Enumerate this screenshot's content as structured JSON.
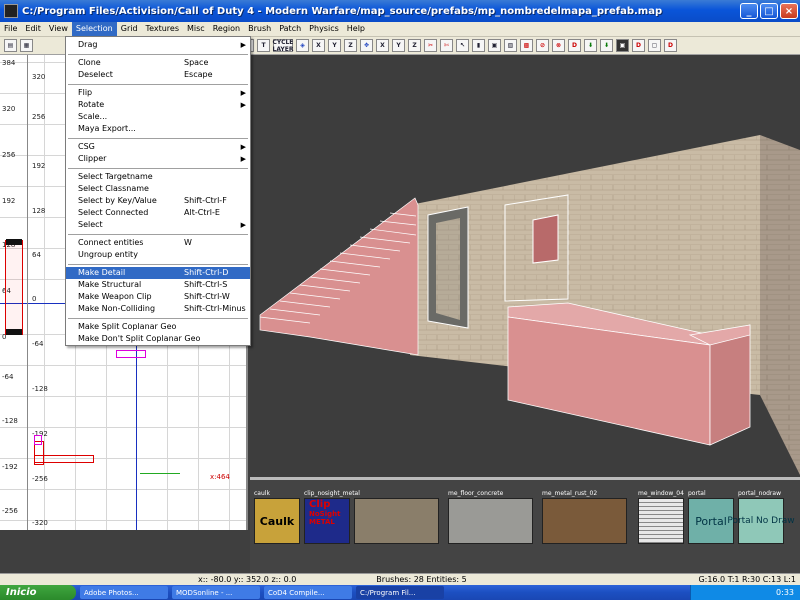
{
  "window": {
    "title": "C:/Program Files/Activision/Call of Duty 4 - Modern Warfare/map_source/prefabs/mp_nombredelmapa_prefab.map",
    "minimize": "_",
    "maximize": "□",
    "close": "×"
  },
  "menubar": [
    "File",
    "Edit",
    "View",
    "Selection",
    "Grid",
    "Textures",
    "Misc",
    "Region",
    "Brush",
    "Patch",
    "Physics",
    "Help"
  ],
  "toolbar": {
    "buttons": [
      "X",
      "Y",
      "Z",
      "X",
      "Y",
      "Z",
      "D",
      "D",
      "D"
    ],
    "cycle_layer": "CYCLE LAYER"
  },
  "selection_menu": {
    "items": [
      {
        "label": "Drag",
        "shortcut": "",
        "arrow": "▶"
      },
      {
        "label": "Clone",
        "shortcut": "Space",
        "arrow": ""
      },
      {
        "label": "Deselect",
        "shortcut": "Escape",
        "arrow": ""
      },
      {
        "label": "Flip",
        "shortcut": "",
        "arrow": "▶"
      },
      {
        "label": "Rotate",
        "shortcut": "",
        "arrow": "▶"
      },
      {
        "label": "Scale...",
        "shortcut": "",
        "arrow": ""
      },
      {
        "label": "Maya Export...",
        "shortcut": "",
        "arrow": ""
      },
      {
        "label": "CSG",
        "shortcut": "",
        "arrow": "▶"
      },
      {
        "label": "Clipper",
        "shortcut": "",
        "arrow": "▶"
      },
      {
        "label": "Select Targetname",
        "shortcut": "",
        "arrow": ""
      },
      {
        "label": "Select Classname",
        "shortcut": "",
        "arrow": ""
      },
      {
        "label": "Select by Key/Value",
        "shortcut": "Shift-Ctrl-F",
        "arrow": ""
      },
      {
        "label": "Select Connected",
        "shortcut": "Alt-Ctrl-E",
        "arrow": ""
      },
      {
        "label": "Select",
        "shortcut": "",
        "arrow": "▶"
      },
      {
        "label": "Connect entities",
        "shortcut": "W",
        "arrow": ""
      },
      {
        "label": "Ungroup entity",
        "shortcut": "",
        "arrow": ""
      },
      {
        "label": "Make Detail",
        "shortcut": "Shift-Ctrl-D",
        "arrow": ""
      },
      {
        "label": "Make Structural",
        "shortcut": "Shift-Ctrl-S",
        "arrow": ""
      },
      {
        "label": "Make Weapon Clip",
        "shortcut": "Shift-Ctrl-W",
        "arrow": ""
      },
      {
        "label": "Make Non-Colliding",
        "shortcut": "Shift-Ctrl-Minus",
        "arrow": ""
      },
      {
        "label": "Make Split Coplanar Geo",
        "shortcut": "",
        "arrow": ""
      },
      {
        "label": "Make Don't Split Coplanar Geo",
        "shortcut": "",
        "arrow": ""
      }
    ]
  },
  "grid2d": {
    "ruler_labels": [
      "384",
      "320",
      "256",
      "192",
      "128",
      "64",
      "0",
      "-64",
      "-128",
      "-192",
      "-256"
    ],
    "inner_labels": [
      "320",
      "256",
      "192",
      "128",
      "64",
      "0",
      "-64",
      "-128",
      "-192",
      "-256",
      "-320"
    ],
    "cursor_label": "x:464"
  },
  "textures": [
    {
      "name": "caulk",
      "label": "Caulk",
      "color": "#c8a23a"
    },
    {
      "name": "clip_nosight_metal",
      "label": "Clip",
      "color": "#1e2a8a"
    },
    {
      "name": "clip_nosight_metal_cinder/block_wall2",
      "label": "",
      "color": "#8a7e6a"
    },
    {
      "name": "me_floor_concrete",
      "label": "",
      "color": "#9a9a96"
    },
    {
      "name": "me_metal_rust_02",
      "label": "",
      "color": "#7a5a3a"
    },
    {
      "name": "me_window_04",
      "label": "",
      "color": "#d8d8d8"
    },
    {
      "name": "portal",
      "label": "Portal",
      "color": "#6fb0a8"
    },
    {
      "name": "portal_nodraw",
      "label": "Portal No Draw",
      "color": "#8fc8b8"
    }
  ],
  "clip_sub": {
    "nosight": "NoSight",
    "metal": "METAL"
  },
  "status": {
    "coords": "x:: -80.0  y:: 352.0  z:: 0.0",
    "counts": "Brushes: 28 Entities: 5",
    "grid": "G:16.0 T:1 R:30 C:13 L:1"
  },
  "taskbar": {
    "start": "Inicio",
    "tasks": [
      "Adobe Photos...",
      "MODSonline - ...",
      "CoD4 Compile...",
      "C:/Program Fil..."
    ],
    "clock": "0:33"
  },
  "colors": {
    "highlight": "#316ac5",
    "brush_pink": "#d99090",
    "wall": "#c9bba5"
  }
}
